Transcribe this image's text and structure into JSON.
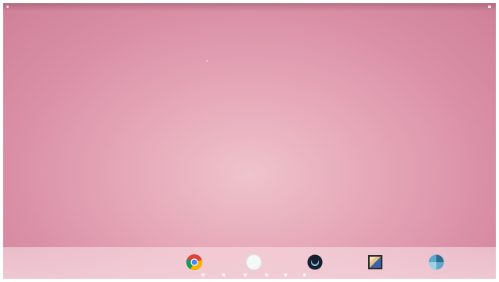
{
  "screen": {
    "wallpaper_colors": [
      "#efc3cc",
      "#e6a8b8",
      "#d98ea6",
      "#cf8099"
    ]
  },
  "dock": {
    "apps": [
      {
        "name": "chrome",
        "icon": "chrome-icon"
      },
      {
        "name": "app-white",
        "icon": "white-circle-app-icon"
      },
      {
        "name": "app-dark",
        "icon": "dark-circle-app-icon"
      },
      {
        "name": "photos",
        "icon": "square-photo-app-icon"
      },
      {
        "name": "app-blue",
        "icon": "blue-circle-app-icon"
      }
    ]
  },
  "nav": {
    "icons": [
      "back-icon",
      "home-icon",
      "recents-icon",
      "menu-icon",
      "settings-icon",
      "notifications-icon"
    ]
  }
}
